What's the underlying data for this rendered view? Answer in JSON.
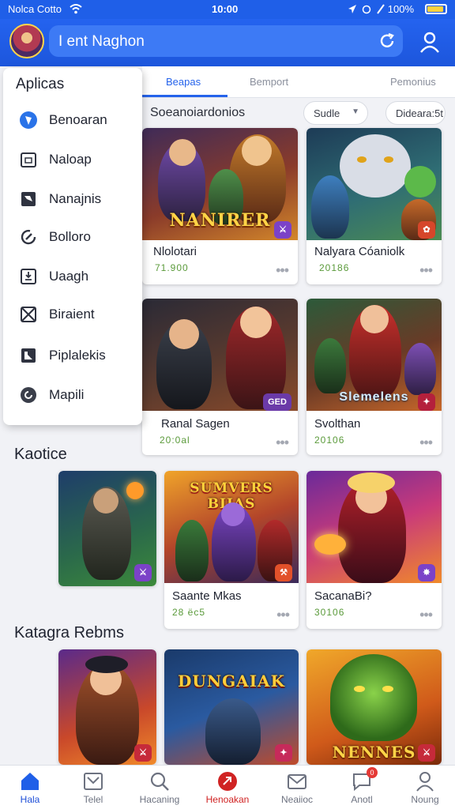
{
  "status_bar": {
    "carrier": "Nolca Cotto",
    "time": "10:00",
    "battery": "100%",
    "battery_level": 0.9
  },
  "header": {
    "search_value": "I ent Naghon"
  },
  "tabs": [
    {
      "label": "Beapas",
      "active": true
    },
    {
      "label": "Bemport",
      "active": false
    },
    {
      "label": "Pemonius",
      "active": false
    }
  ],
  "filter": {
    "title": "Soeanoiardonios",
    "sort_label": "Sudle",
    "second_chip": "Dideara:5t"
  },
  "drawer": {
    "title": "Aplicas",
    "items": [
      {
        "label": "Benoaran",
        "icon": "shield-icon"
      },
      {
        "label": "Naloap",
        "icon": "calendar-icon"
      },
      {
        "label": "Nanajnis",
        "icon": "image-icon"
      },
      {
        "label": "Bolloro",
        "icon": "gauge-icon"
      },
      {
        "label": "Uaagh",
        "icon": "download-box-icon"
      },
      {
        "label": "Biraient",
        "icon": "x-box-icon"
      },
      {
        "label": "Piplalekis",
        "icon": "puzzle-icon"
      },
      {
        "label": "Mapili",
        "icon": "refresh-circle-icon"
      }
    ]
  },
  "grid_top": [
    {
      "title": "Nlolotari",
      "sub": "71.900",
      "art_text": "NANIRER",
      "badge": "⚔"
    },
    {
      "title": "Nalyara Cóaniolk",
      "sub": "20186",
      "art_text": "",
      "badge": "✿"
    },
    {
      "title": "Ranal Sagen",
      "sub": "20:0al",
      "art_text": "",
      "badge": "GED"
    },
    {
      "title": "Svolthan",
      "sub": "20106",
      "art_text": "Slemelens",
      "badge": "✦"
    }
  ],
  "sections": [
    {
      "title": "Kaotice",
      "cards": [
        {
          "title": "",
          "sub": "",
          "art_text": "",
          "badge": "⚔"
        },
        {
          "title": "Saante Mkas",
          "sub": "28 ёc5",
          "art_text": "SUMVERS BIIAS",
          "badge": "⚒"
        },
        {
          "title": "SacanaBi?",
          "sub": "30106",
          "art_text": "",
          "badge": "✸"
        }
      ]
    },
    {
      "title": "Katagra Rebms",
      "cards": [
        {
          "art_text": "",
          "badge": "⚔"
        },
        {
          "art_text": "DUNGAIAK",
          "badge": "✦"
        },
        {
          "art_text": "NENNES",
          "badge": "⚔"
        }
      ]
    }
  ],
  "bottom_nav": [
    {
      "label": "Hala",
      "icon": "home-icon",
      "state": "active"
    },
    {
      "label": "Telel",
      "icon": "inbox-icon",
      "state": ""
    },
    {
      "label": "Hacaning",
      "icon": "search-icon",
      "state": ""
    },
    {
      "label": "Henoakan",
      "icon": "target-icon",
      "state": "red"
    },
    {
      "label": "Neaiioc",
      "icon": "mail-icon",
      "state": ""
    },
    {
      "label": "Anotl",
      "icon": "chat-icon",
      "state": "",
      "badge": "0"
    },
    {
      "label": "Noung",
      "icon": "person-icon",
      "state": ""
    }
  ],
  "colors": {
    "primary": "#1f5fe8",
    "accent_red": "#d02323",
    "price_green": "#5a9a3a"
  }
}
